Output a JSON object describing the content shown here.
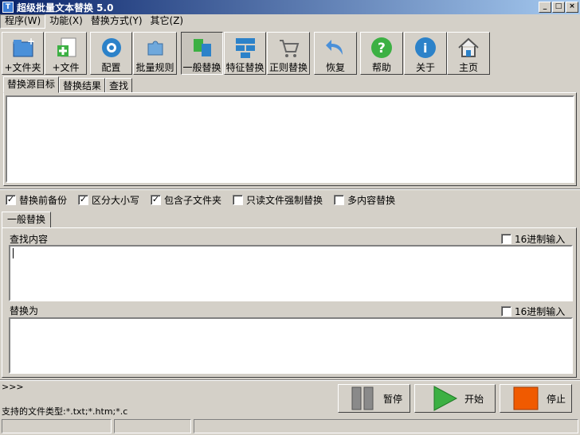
{
  "window": {
    "title": "超级批量文本替换 5.0"
  },
  "menu": [
    "程序(W)",
    "功能(X)",
    "替换方式(Y)",
    "其它(Z)"
  ],
  "toolbar": [
    {
      "label": "+文件夹",
      "icon": "add-folder-icon"
    },
    {
      "label": "+文件",
      "icon": "add-file-icon"
    },
    {
      "label": "配置",
      "icon": "config-icon"
    },
    {
      "label": "批量规则",
      "icon": "puzzle-icon"
    },
    {
      "label": "一般替换",
      "icon": "normal-replace-icon"
    },
    {
      "label": "特征替换",
      "icon": "feature-replace-icon"
    },
    {
      "label": "正则替换",
      "icon": "regex-replace-icon"
    },
    {
      "label": "恢复",
      "icon": "restore-icon"
    },
    {
      "label": "帮助",
      "icon": "help-icon"
    },
    {
      "label": "关于",
      "icon": "about-icon"
    },
    {
      "label": "主页",
      "icon": "home-icon"
    }
  ],
  "tabs": [
    "替换源目标",
    "替换结果",
    "查找"
  ],
  "options": [
    {
      "label": "替换前备份",
      "checked": true
    },
    {
      "label": "区分大小写",
      "checked": true
    },
    {
      "label": "包含子文件夹",
      "checked": true
    },
    {
      "label": "只读文件强制替换",
      "checked": false
    },
    {
      "label": "多内容替换",
      "checked": false
    }
  ],
  "general": {
    "tab_label": "一般替换",
    "find_label": "查找内容",
    "replace_label": "替换为",
    "hex_label": "16进制输入",
    "find_value": "",
    "replace_value": ""
  },
  "footer": {
    "prompt": ">>>",
    "supported_types": "支持的文件类型:*.txt;*.htm;*.c",
    "pause_label": "暂停",
    "start_label": "开始",
    "stop_label": "停止"
  },
  "colors": {
    "start": "#3cb043",
    "stop": "#f05a00",
    "titlebar": "#0a246a"
  }
}
